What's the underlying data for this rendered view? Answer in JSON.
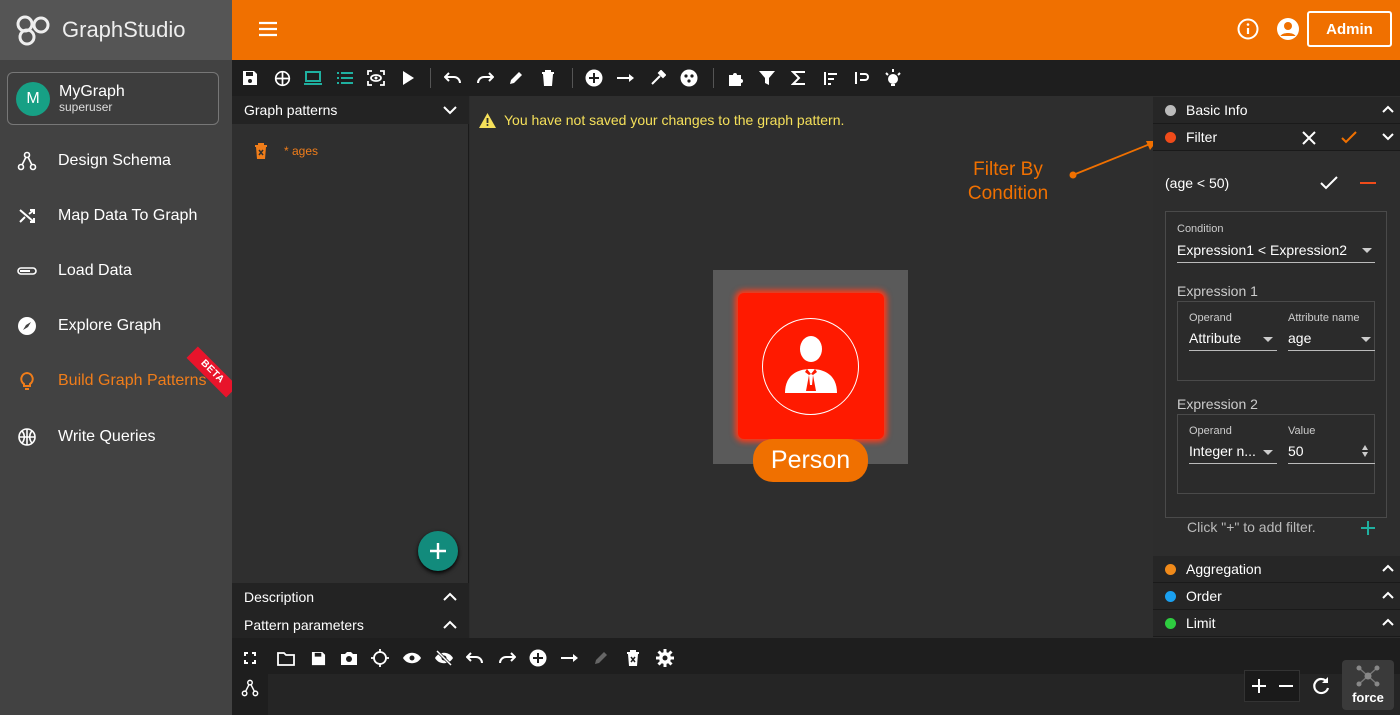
{
  "app": {
    "title": "GraphStudio"
  },
  "header": {
    "admin_label": "Admin"
  },
  "graph": {
    "initial": "M",
    "name": "MyGraph",
    "user": "superuser"
  },
  "nav": [
    {
      "label": "Design Schema"
    },
    {
      "label": "Map Data To Graph"
    },
    {
      "label": "Load Data"
    },
    {
      "label": "Explore Graph"
    },
    {
      "label": "Build Graph Patterns",
      "badge": "BETA"
    },
    {
      "label": "Write Queries"
    }
  ],
  "left_panel": {
    "patterns_title": "Graph patterns",
    "pattern_item": "* ages",
    "description_title": "Description",
    "params_title": "Pattern parameters"
  },
  "canvas": {
    "warning": "You have not saved your changes to the graph pattern.",
    "vertex_label": "Person",
    "annotation": [
      "Filter By",
      "Condition"
    ]
  },
  "right_panel": {
    "basic_info": "Basic Info",
    "filter": "Filter",
    "filter_expr": "(age < 50)",
    "condition_label": "Condition",
    "condition_value": "Expression1 < Expression2",
    "expr1_title": "Expression 1",
    "expr1_operand_label": "Operand",
    "expr1_operand_value": "Attribute",
    "expr1_attr_label": "Attribute name",
    "expr1_attr_value": "age",
    "expr2_title": "Expression 2",
    "expr2_operand_label": "Operand",
    "expr2_operand_value": "Integer n...",
    "expr2_value_label": "Value",
    "expr2_value": "50",
    "add_hint": "Click \"+\" to add filter.",
    "aggregation": "Aggregation",
    "order": "Order",
    "limit": "Limit"
  },
  "bottom": {
    "layout_label": "force"
  },
  "colors": {
    "accent": "#f07000",
    "vertex": "#ff0000",
    "teal": "#128b7c",
    "filter_dot": "#f04b1a",
    "aggregation_dot": "#f08a1a",
    "order_dot": "#1aa0f0",
    "limit_dot": "#2ecc40"
  }
}
